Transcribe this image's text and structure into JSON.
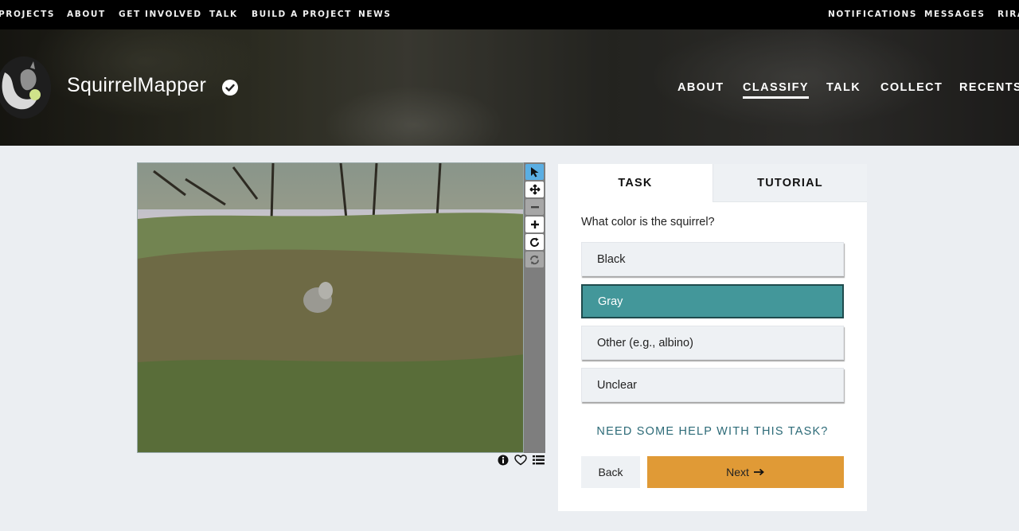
{
  "top_nav": {
    "left": [
      "PROJECTS",
      "ABOUT",
      "GET INVOLVED",
      "TALK",
      "BUILD A PROJECT",
      "NEWS"
    ],
    "right": [
      "NOTIFICATIONS",
      "MESSAGES",
      "RIRA"
    ]
  },
  "project": {
    "title": "SquirrelMapper",
    "nav": [
      "ABOUT",
      "CLASSIFY",
      "TALK",
      "COLLECT",
      "RECENTS"
    ],
    "active_nav": "CLASSIFY"
  },
  "viewer": {
    "tools": [
      "pointer-icon",
      "move-icon",
      "zoom-out-icon",
      "zoom-in-icon",
      "rotate-icon",
      "reset-icon"
    ],
    "active_tool": "pointer-icon",
    "meta_icons": [
      "info-icon",
      "favorite-heart-icon",
      "collections-list-icon"
    ]
  },
  "task_panel": {
    "tabs": [
      "TASK",
      "TUTORIAL"
    ],
    "active_tab": "TASK",
    "question": "What color is the squirrel?",
    "answers": [
      "Black",
      "Gray",
      "Other (e.g., albino)",
      "Unclear"
    ],
    "selected_answer": "Gray",
    "help_link": "NEED SOME HELP WITH THIS TASK?",
    "back_label": "Back",
    "next_label": "Next"
  },
  "colors": {
    "selected_answer": "#43979a",
    "next_button": "#e09a36",
    "active_tool": "#5aaee3",
    "help_link": "#2c6a77"
  }
}
